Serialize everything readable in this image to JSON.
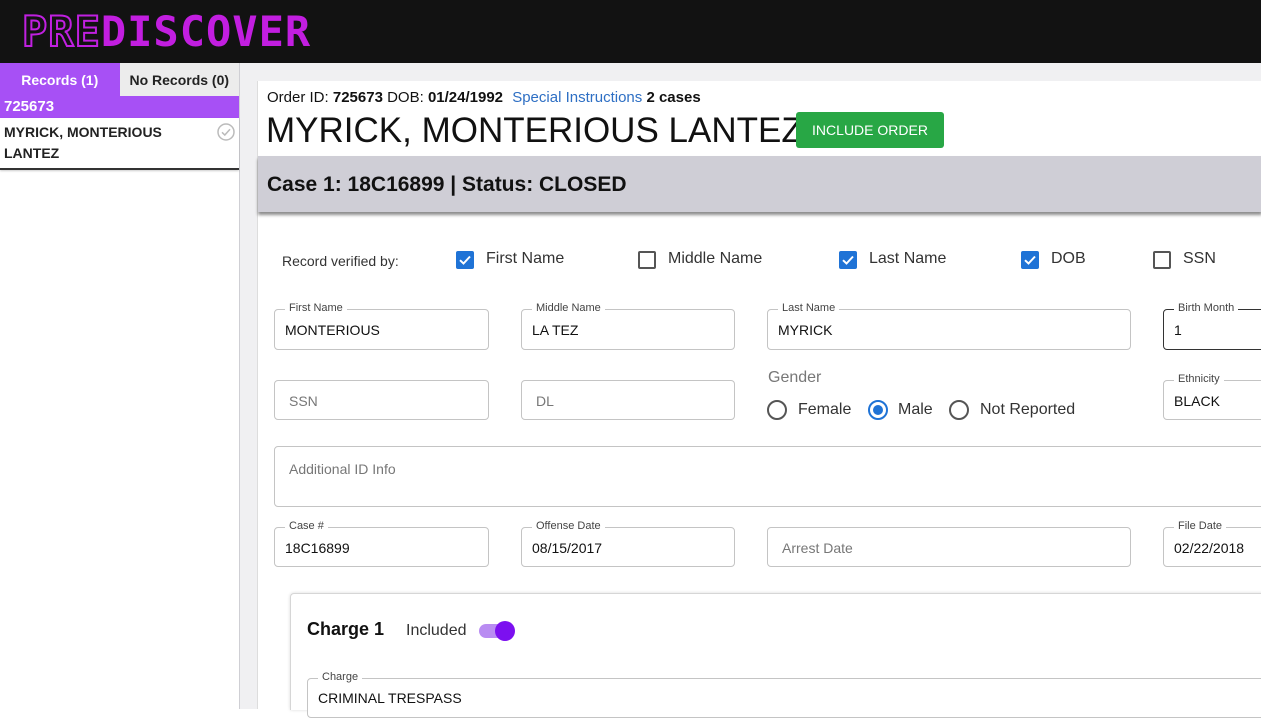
{
  "app": {
    "logo_prefix": "PRE",
    "logo_suffix": "DISCOVER"
  },
  "sidebar": {
    "tabs": [
      {
        "label": "Records (1)",
        "active": true
      },
      {
        "label": "No Records (0)",
        "active": false
      }
    ],
    "record": {
      "id": "725673",
      "name": "MYRICK, MONTERIOUS LANTEZ"
    }
  },
  "order": {
    "id_label": "Order ID:",
    "id": "725673",
    "dob_label": "DOB:",
    "dob": "01/24/1992",
    "special_instructions": "Special Instructions",
    "cases": "2 cases",
    "name": "MYRICK, MONTERIOUS LANTEZ",
    "include_button": "INCLUDE ORDER"
  },
  "case": {
    "title": "Case 1: 18C16899 | Status: CLOSED"
  },
  "verification": {
    "label": "Record verified by:",
    "options": [
      {
        "label": "First Name",
        "checked": true
      },
      {
        "label": "Middle Name",
        "checked": false
      },
      {
        "label": "Last Name",
        "checked": true
      },
      {
        "label": "DOB",
        "checked": true
      },
      {
        "label": "SSN",
        "checked": false
      }
    ]
  },
  "fields": {
    "first_name": {
      "label": "First Name",
      "value": "MONTERIOUS"
    },
    "middle_name": {
      "label": "Middle Name",
      "value": "LA TEZ"
    },
    "last_name": {
      "label": "Last Name",
      "value": "MYRICK"
    },
    "birth_month": {
      "label": "Birth Month",
      "value": "1"
    },
    "ssn": {
      "placeholder": "SSN"
    },
    "dl": {
      "placeholder": "DL"
    },
    "ethnicity": {
      "label": "Ethnicity",
      "value": "BLACK"
    },
    "additional_id": {
      "placeholder": "Additional ID Info"
    },
    "case_number": {
      "label": "Case #",
      "value": "18C16899"
    },
    "offense_date": {
      "label": "Offense Date",
      "value": "08/15/2017"
    },
    "arrest_date": {
      "placeholder": "Arrest Date"
    },
    "file_date": {
      "label": "File Date",
      "value": "02/22/2018"
    }
  },
  "gender": {
    "label": "Gender",
    "options": [
      {
        "label": "Female",
        "selected": false
      },
      {
        "label": "Male",
        "selected": true
      },
      {
        "label": "Not Reported",
        "selected": false
      }
    ]
  },
  "charge": {
    "title": "Charge 1",
    "included_label": "Included",
    "included": true,
    "charge_label": "Charge",
    "charge_value": "CRIMINAL TRESPASS"
  },
  "colors": {
    "accent": "#a750f5",
    "logo": "#c21ee0",
    "primary": "#1f73d6",
    "success": "#28a745"
  }
}
